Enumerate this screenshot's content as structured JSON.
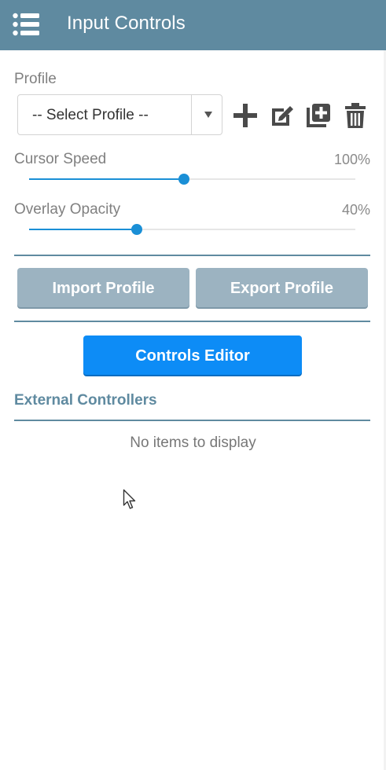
{
  "header": {
    "title": "Input Controls",
    "background_color": "#5f8aa0",
    "menu_icon": "hamburger-list-icon"
  },
  "profile": {
    "label": "Profile",
    "select": {
      "selected": "-- Select Profile --"
    },
    "actions": [
      {
        "name": "add-profile-button",
        "icon": "plus-icon"
      },
      {
        "name": "edit-profile-button",
        "icon": "edit-icon"
      },
      {
        "name": "duplicate-profile-button",
        "icon": "duplicate-icon"
      },
      {
        "name": "delete-profile-button",
        "icon": "trash-icon"
      }
    ]
  },
  "sliders": {
    "cursor_speed": {
      "label": "Cursor Speed",
      "value_text": "100%",
      "fraction": 0.475
    },
    "overlay_opacity": {
      "label": "Overlay Opacity",
      "value_text": "40%",
      "fraction": 0.33
    },
    "accent_color": "#1a8fd6"
  },
  "buttons": {
    "import": "Import Profile",
    "export": "Export Profile",
    "controls_editor": "Controls Editor",
    "gray_color": "#9cb3c1",
    "blue_color": "#0d8cf6"
  },
  "external": {
    "title": "External Controllers",
    "empty_message": "No items to display"
  }
}
